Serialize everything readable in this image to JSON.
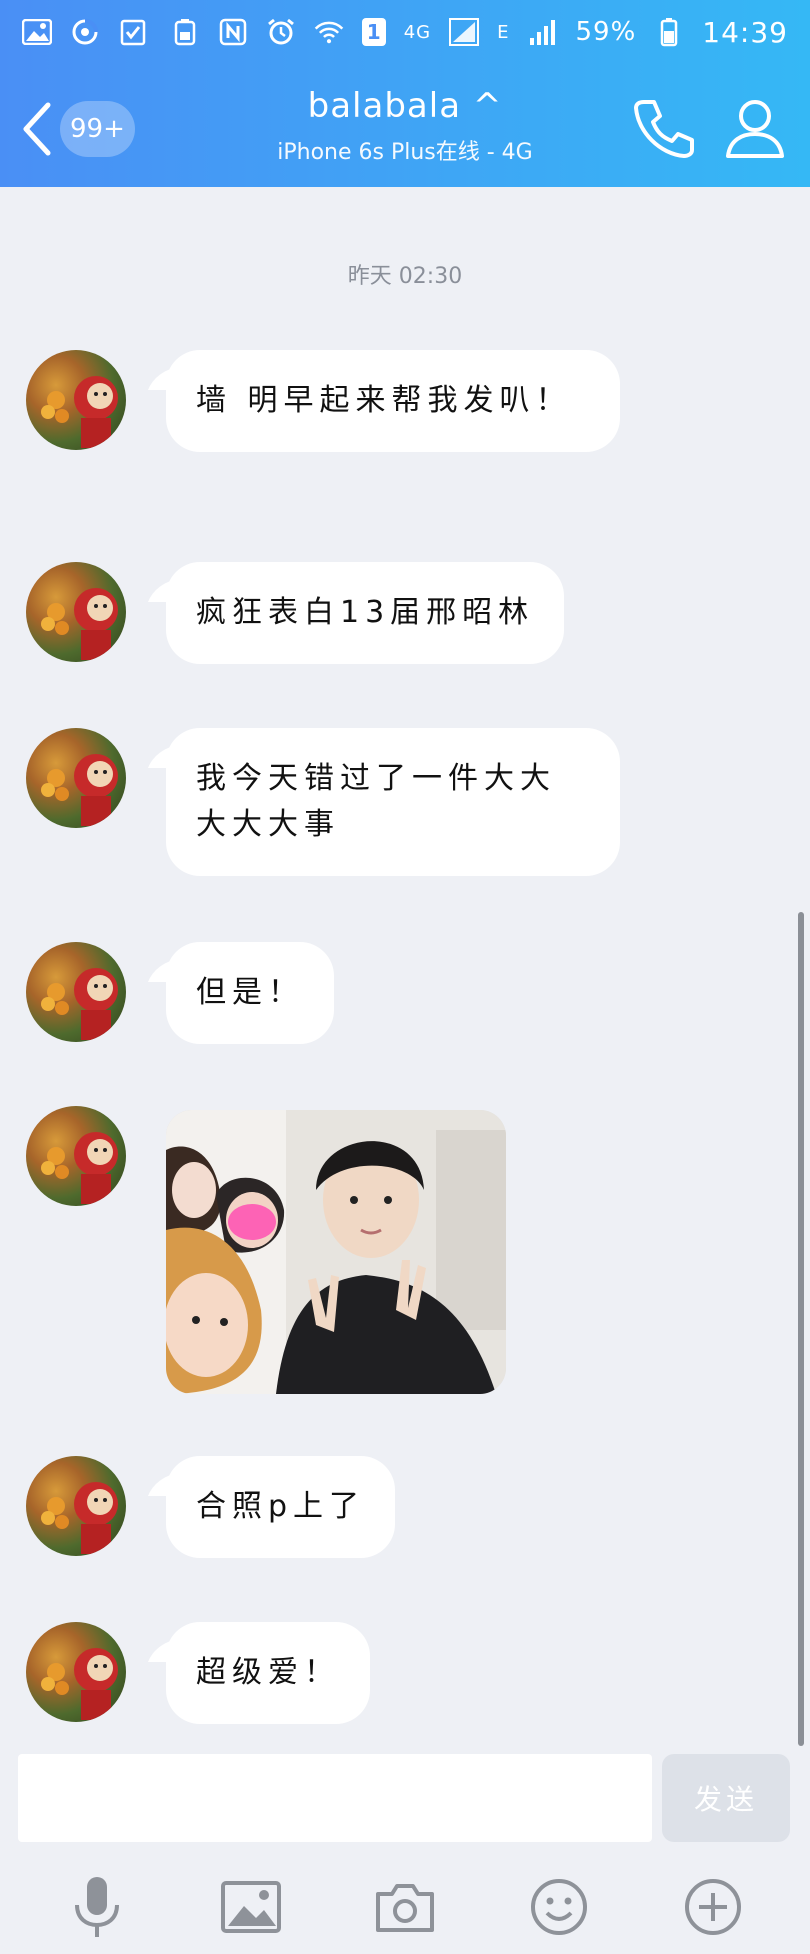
{
  "status_bar": {
    "network": "4G",
    "network_e": "E",
    "sim_badge": "1",
    "battery": "59%",
    "time": "14:39"
  },
  "header": {
    "back_badge": "99+",
    "title": "balabala ^",
    "subtitle": "iPhone 6s Plus在线 - 4G"
  },
  "timestamp": "昨天 02:30",
  "messages": [
    {
      "text": "墙 明早起来帮我发叭！"
    },
    {
      "text": "疯狂表白13届邢昭林"
    },
    {
      "text": "我今天错过了一件大大大大大事"
    },
    {
      "text": "但是！"
    },
    {
      "type": "image"
    },
    {
      "text": "合照p上了"
    },
    {
      "text": "超级爱！"
    }
  ],
  "input": {
    "placeholder": "",
    "send_label": "发送"
  },
  "colors": {
    "header_start": "#4a8ff5",
    "header_end": "#35b8f5",
    "background": "#eef0f5",
    "bubble": "#ffffff"
  },
  "icons": {
    "toolbar": [
      "microphone-icon",
      "image-icon",
      "camera-icon",
      "emoji-icon",
      "plus-icon"
    ]
  }
}
